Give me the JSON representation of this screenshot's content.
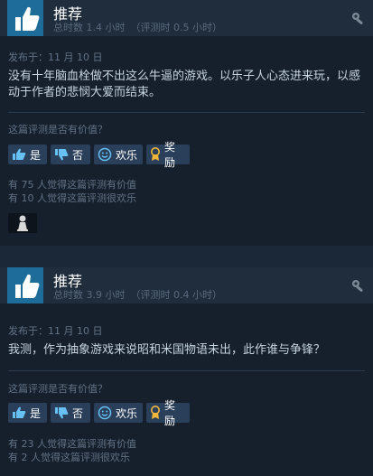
{
  "reviews": [
    {
      "verdict": "推荐",
      "hours_total": "总时数 1.4 小时",
      "hours_review": "（评测时 0.5 小时）",
      "posted": "发布于：11 月 10 日",
      "text": "没有十年脑血栓做不出这么牛逼的游戏。以乐子人心态进来玩，以感动于作者的悲悯大爱而结束。",
      "helpful_question": "这篇评测是否有价值？",
      "buttons": {
        "yes": "是",
        "no": "否",
        "funny": "欢乐",
        "award": "奖励"
      },
      "helpful_count": "有 75 人觉得这篇评测有价值",
      "funny_count": "有 10 人觉得这篇评测很欢乐"
    },
    {
      "verdict": "推荐",
      "hours_total": "总时数 3.9 小时",
      "hours_review": "（评测时 0.4 小时）",
      "posted": "发布于：11 月 10 日",
      "text": "我测，作为抽象游戏来说昭和米国物语未出，此作谁与争锋？",
      "helpful_question": "这篇评测是否有价值？",
      "buttons": {
        "yes": "是",
        "no": "否",
        "funny": "欢乐",
        "award": "奖励"
      },
      "helpful_count": "有 23 人觉得这篇评测有价值",
      "funny_count": "有 2 人觉得这篇评测很欢乐"
    }
  ],
  "colors": {
    "background": "#1b2838",
    "card": "#16202d",
    "header": "#1f2d3d",
    "thumb": "#1e6c9a",
    "button": "#2a3f5a",
    "award": "#f0b63a"
  },
  "icons": [
    "thumbs-up-icon",
    "thumbs-down-icon",
    "smiley-icon",
    "award-icon",
    "gear-icon",
    "avatar-figure-icon"
  ]
}
